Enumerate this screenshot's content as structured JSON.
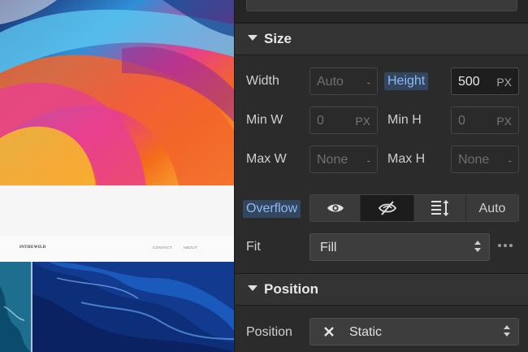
{
  "canvas": {
    "site_logo": "INTHEWILD",
    "nav_links": [
      "CONTACT",
      "ABOUT"
    ]
  },
  "size_section": {
    "title": "Size",
    "width": {
      "label": "Width",
      "value": "Auto",
      "unit": "-"
    },
    "height": {
      "label": "Height",
      "value": "500",
      "unit": "PX"
    },
    "min_w": {
      "label": "Min W",
      "value": "0",
      "unit": "PX"
    },
    "min_h": {
      "label": "Min H",
      "value": "0",
      "unit": "PX"
    },
    "max_w": {
      "label": "Max W",
      "value": "None",
      "unit": "-"
    },
    "max_h": {
      "label": "Max H",
      "value": "None",
      "unit": "-"
    },
    "overflow": {
      "label": "Overflow",
      "options": [
        "visible",
        "hidden",
        "scroll",
        "Auto"
      ],
      "selected": "hidden"
    },
    "fit": {
      "label": "Fit",
      "value": "Fill"
    }
  },
  "position_section": {
    "title": "Position",
    "label": "Position",
    "value": "Static"
  },
  "icons": [
    "eye-icon",
    "eye-off-icon",
    "scroll-icon",
    "close-icon",
    "updown-arrows-icon",
    "more-icon",
    "caret-down-icon"
  ],
  "colors": {
    "highlight_bg": "#33465f",
    "highlight_text": "#8fb9f5",
    "panel_bg": "#2b2b2b"
  }
}
